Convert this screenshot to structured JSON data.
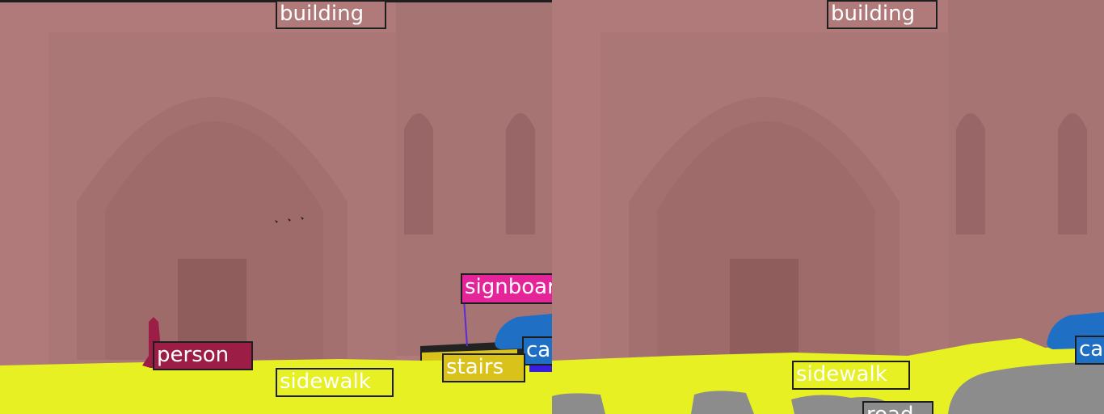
{
  "colors": {
    "building": "#b87d7d",
    "sidewalk": "#e6f023",
    "road": "#8c8c8c",
    "person": "#9c1e46",
    "signboard": "#e6249a",
    "car": "#1f6fc4",
    "stairs": "#d9c21a"
  },
  "left_panel": {
    "labels": {
      "building": "building",
      "signboard": "signboard",
      "car": "car",
      "person": "person",
      "stairs": "stairs",
      "sidewalk": "sidewalk"
    }
  },
  "right_panel": {
    "labels": {
      "building": "building",
      "car": "car",
      "sidewalk": "sidewalk",
      "road": "road"
    }
  }
}
